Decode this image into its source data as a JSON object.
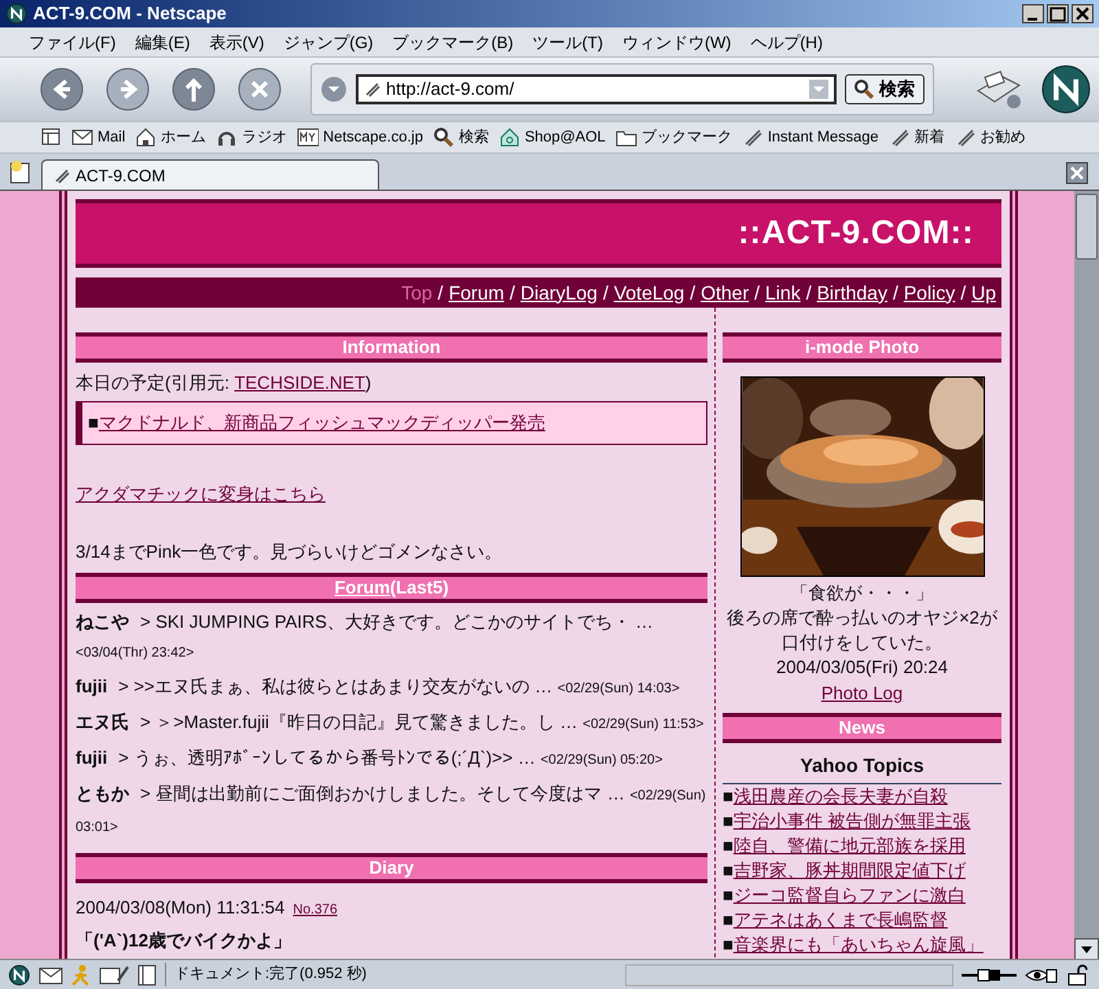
{
  "window": {
    "title": "ACT-9.COM - Netscape"
  },
  "menu": [
    "ファイル(F)",
    "編集(E)",
    "表示(V)",
    "ジャンプ(G)",
    "ブックマーク(B)",
    "ツール(T)",
    "ウィンドウ(W)",
    "ヘルプ(H)"
  ],
  "address": {
    "value": "http://act-9.com/",
    "search_button": "検索"
  },
  "personal_toolbar": [
    {
      "kind": "mail",
      "label": "Mail"
    },
    {
      "kind": "home",
      "label": "ホーム"
    },
    {
      "kind": "radio",
      "label": "ラジオ"
    },
    {
      "kind": "my",
      "label": "Netscape.co.jp"
    },
    {
      "kind": "search",
      "label": "検索"
    },
    {
      "kind": "shop",
      "label": "Shop@AOL"
    },
    {
      "kind": "folder",
      "label": "ブックマーク"
    },
    {
      "kind": "bookmark",
      "label": "Instant Message"
    },
    {
      "kind": "bookmark",
      "label": "新着"
    },
    {
      "kind": "bookmark",
      "label": "お勧め"
    }
  ],
  "tabs": [
    {
      "label": "ACT-9.COM",
      "selected": true
    }
  ],
  "page": {
    "site_title": "::ACT-9.COM::",
    "nav_separator": "/",
    "nav": [
      {
        "label": "Top",
        "selected": true
      },
      {
        "label": "Forum",
        "selected": false
      },
      {
        "label": "DiaryLog",
        "selected": false
      },
      {
        "label": "VoteLog",
        "selected": false
      },
      {
        "label": "Other",
        "selected": false
      },
      {
        "label": "Link",
        "selected": false
      },
      {
        "label": "Birthday",
        "selected": false
      },
      {
        "label": "Policy",
        "selected": false
      },
      {
        "label": "Up",
        "selected": false
      }
    ],
    "information": {
      "header": "Information",
      "schedule_prefix": "本日の予定(引用元: ",
      "schedule_source": "TECHSIDE.NET",
      "schedule_suffix": ")",
      "headline_bullet": "■",
      "headline": "マクドナルド、新商品フィッシュマックディッパー発売",
      "transform_link": "アクダマチックに変身はこちら",
      "notice": "3/14までPink一色です。見づらいけどゴメンなさい。"
    },
    "forum": {
      "header_link": "Forum",
      "header_suffix": "(Last5)",
      "entries": [
        {
          "author": "ねこや",
          "separator": ">",
          "text": "SKI JUMPING PAIRS、大好きです。どこかのサイトでち・ …",
          "date": "<03/04(Thr) 23:42>"
        },
        {
          "author": "fujii",
          "separator": ">",
          "text": ">>エヌ氏まぁ、私は彼らとはあまり交友がないの …",
          "date": "<02/29(Sun) 14:03>"
        },
        {
          "author": "エヌ氏",
          "separator": ">",
          "text": "＞>Master.fujii『昨日の日記』見て驚きました。し …",
          "date": "<02/29(Sun) 11:53>"
        },
        {
          "author": "fujii",
          "separator": ">",
          "text": "うぉ、透明ｱﾎﾞｰﾝしてるから番号ﾄﾝでる(;´Д`)>> …",
          "date": "<02/29(Sun) 05:20>"
        },
        {
          "author": "ともか",
          "separator": ">",
          "text": "昼間は出勤前にご面倒おかけしました。そして今度はマ …",
          "date": "<02/29(Sun) 03:01>"
        }
      ]
    },
    "diary": {
      "header": "Diary",
      "date": "2004/03/08(Mon) 11:31:54",
      "number": "No.376",
      "title": "「('A`)12歳でバイクかよ」"
    },
    "photo": {
      "header": "i-mode Photo",
      "kind": "picture",
      "caption": [
        "「食欲が・・・」",
        "後ろの席で酔っ払いのオヤジ×2が",
        "口付けをしていた。"
      ],
      "date": "2004/03/05(Fri) 20:24",
      "log_link": "Photo Log"
    },
    "news": {
      "header": "News",
      "subheader": "Yahoo Topics",
      "bullet": "■",
      "items": [
        "浅田農産の会長夫妻が自殺",
        "宇治小事件 被告側が無罪主張",
        "陸自、警備に地元部族を採用",
        "吉野家、豚丼期間限定値下げ",
        "ジーコ監督自らファンに激白",
        "アテネはあくまで長嶋監督",
        "音楽界にも「あいちゃん旋風」"
      ]
    }
  },
  "status_bar": {
    "text": "ドキュメント:完了(0.952 秒)"
  }
}
